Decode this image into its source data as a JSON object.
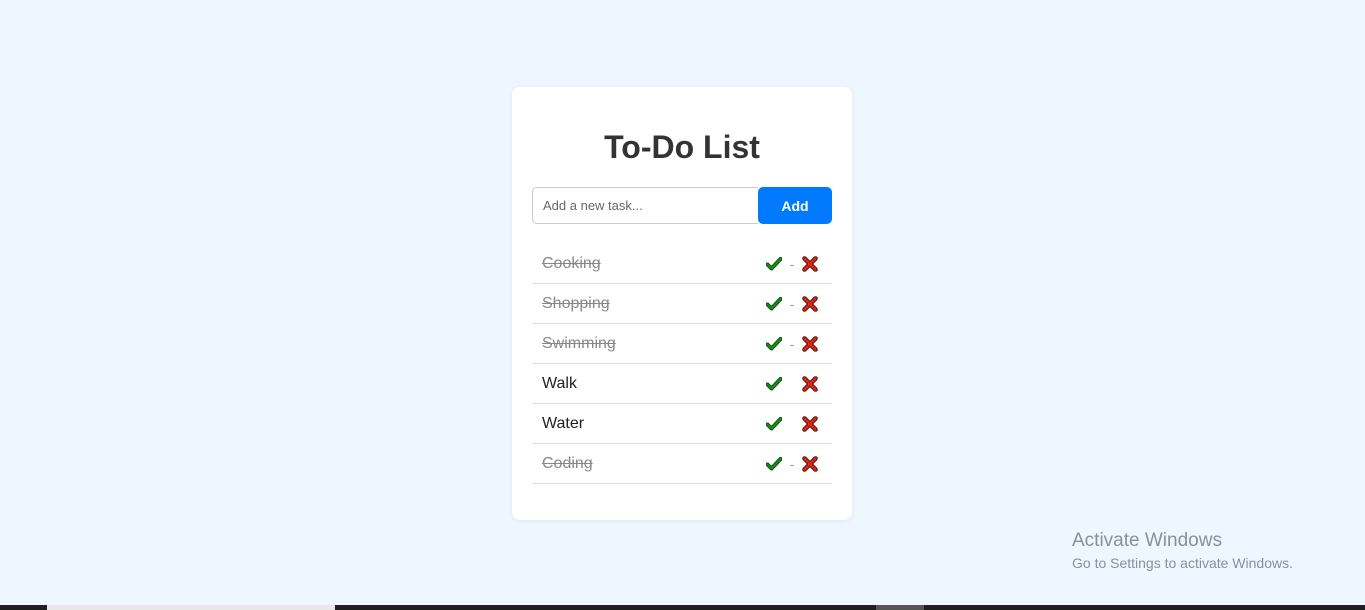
{
  "app": {
    "title": "To-Do List"
  },
  "input": {
    "placeholder": "Add a new task...",
    "value": ""
  },
  "add_button": {
    "label": "Add"
  },
  "tasks": [
    {
      "text": "Cooking",
      "done": true,
      "separator": "-"
    },
    {
      "text": "Shopping",
      "done": true,
      "separator": "-"
    },
    {
      "text": "Swimming",
      "done": true,
      "separator": "-"
    },
    {
      "text": "Walk",
      "done": false,
      "separator": ""
    },
    {
      "text": "Water",
      "done": false,
      "separator": ""
    },
    {
      "text": "Coding",
      "done": true,
      "separator": "-"
    }
  ],
  "icons": {
    "complete": "check-icon",
    "delete": "x-icon"
  },
  "colors": {
    "background": "#eef6ff",
    "accent": "#007bff",
    "check": "#1a8a1a",
    "delete": "#d62a1a"
  },
  "watermark": {
    "line1": "Activate Windows",
    "line2": "Go to Settings to activate Windows."
  }
}
